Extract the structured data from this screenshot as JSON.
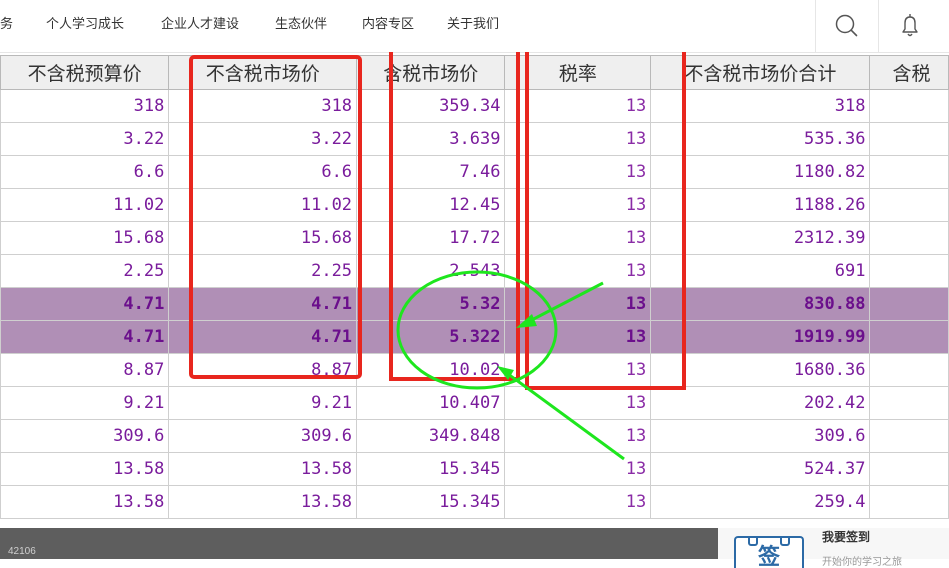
{
  "nav": {
    "items": [
      "服务",
      "个人学习成长",
      "企业人才建设",
      "生态伙伴",
      "内容专区",
      "关于我们"
    ],
    "icons": [
      "search-icon",
      "bell-icon"
    ]
  },
  "table": {
    "columns": [
      "不含税预算价",
      "不含税市场价",
      "含税市场价",
      "税率",
      "不含税市场价合计",
      "含税"
    ],
    "rows": [
      {
        "cells": [
          "318",
          "318",
          "359.34",
          "13",
          "318",
          ""
        ],
        "highlight": false
      },
      {
        "cells": [
          "3.22",
          "3.22",
          "3.639",
          "13",
          "535.36",
          ""
        ],
        "highlight": false
      },
      {
        "cells": [
          "6.6",
          "6.6",
          "7.46",
          "13",
          "1180.82",
          ""
        ],
        "highlight": false
      },
      {
        "cells": [
          "11.02",
          "11.02",
          "12.45",
          "13",
          "1188.26",
          ""
        ],
        "highlight": false
      },
      {
        "cells": [
          "15.68",
          "15.68",
          "17.72",
          "13",
          "2312.39",
          ""
        ],
        "highlight": false
      },
      {
        "cells": [
          "2.25",
          "2.25",
          "2.543",
          "13",
          "691",
          ""
        ],
        "highlight": false
      },
      {
        "cells": [
          "4.71",
          "4.71",
          "5.32",
          "13",
          "830.88",
          ""
        ],
        "highlight": true
      },
      {
        "cells": [
          "4.71",
          "4.71",
          "5.322",
          "13",
          "1919.99",
          ""
        ],
        "highlight": true
      },
      {
        "cells": [
          "8.87",
          "8.87",
          "10.02",
          "13",
          "1680.36",
          ""
        ],
        "highlight": false
      },
      {
        "cells": [
          "9.21",
          "9.21",
          "10.407",
          "13",
          "202.42",
          ""
        ],
        "highlight": false
      },
      {
        "cells": [
          "309.6",
          "309.6",
          "349.848",
          "13",
          "309.6",
          ""
        ],
        "highlight": false
      },
      {
        "cells": [
          "13.58",
          "13.58",
          "15.345",
          "13",
          "524.37",
          ""
        ],
        "highlight": false
      },
      {
        "cells": [
          "13.58",
          "13.58",
          "15.345",
          "13",
          "259.4",
          ""
        ],
        "highlight": false
      }
    ]
  },
  "bottom": {
    "id_text": "42106",
    "signin_title": "我要签到",
    "signin_badge": "签",
    "signin_sub": "开始你的学习之旅"
  },
  "colors": {
    "cell_text": "#7a1c9c",
    "row_highlight": "#b08fb6",
    "annotation_red": "#e8261e",
    "annotation_green": "#1ee61e"
  }
}
